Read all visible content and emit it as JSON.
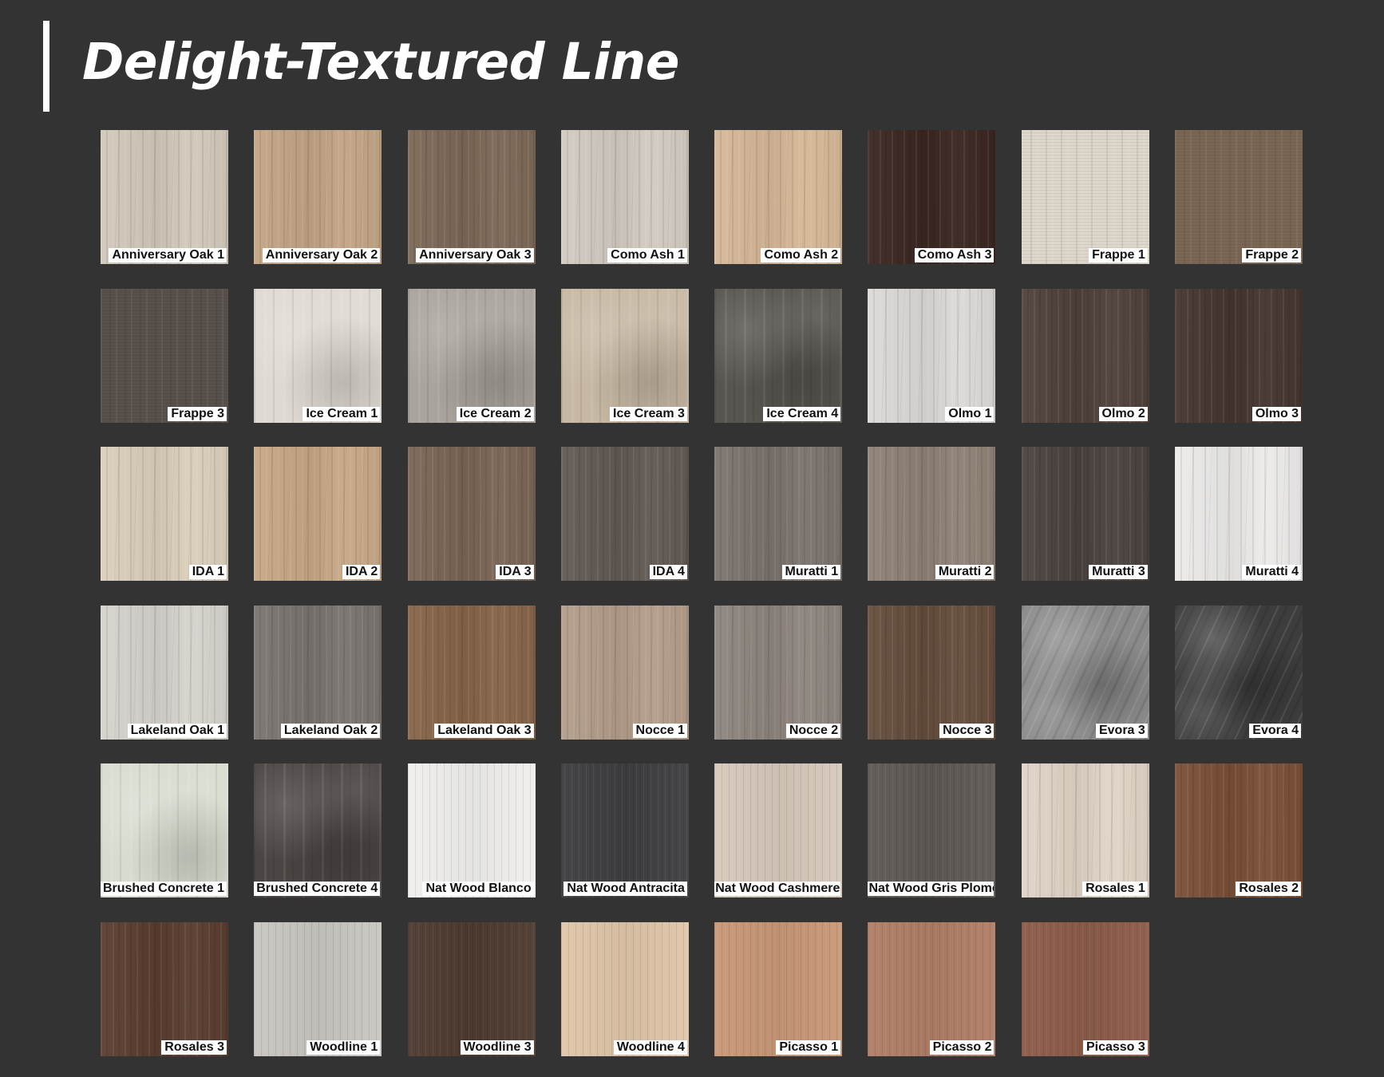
{
  "title": "Delight-Textured Line",
  "swatches": [
    {
      "label": "Anniversary Oak 1",
      "base": "#d2c9bb",
      "grain": "vertical"
    },
    {
      "label": "Anniversary Oak 2",
      "base": "#c3a585",
      "grain": "vertical"
    },
    {
      "label": "Anniversary Oak 3",
      "base": "#7c6856",
      "grain": "vertical"
    },
    {
      "label": "Como Ash 1",
      "base": "#d3cbc1",
      "grain": "vertical"
    },
    {
      "label": "Como Ash 2",
      "base": "#d6b897",
      "grain": "vertical"
    },
    {
      "label": "Como Ash 3",
      "base": "#3b2621",
      "grain": "vertical"
    },
    {
      "label": "Frappe 1",
      "base": "#ddd6cb",
      "grain": "linen"
    },
    {
      "label": "Frappe 2",
      "base": "#7b6654",
      "grain": "linen"
    },
    {
      "label": "Frappe 3",
      "base": "#57504b",
      "grain": "linen"
    },
    {
      "label": "Ice Cream 1",
      "base": "#ded9d2",
      "grain": "mottled"
    },
    {
      "label": "Ice Cream 2",
      "base": "#a8a39c",
      "grain": "mottled"
    },
    {
      "label": "Ice Cream 3",
      "base": "#c7b8a3",
      "grain": "mottled"
    },
    {
      "label": "Ice Cream 4",
      "base": "#58544f",
      "grain": "mottled"
    },
    {
      "label": "Olmo 1",
      "base": "#dcdad6",
      "grain": "vertical"
    },
    {
      "label": "Olmo 2",
      "base": "#4f4139",
      "grain": "vertical"
    },
    {
      "label": "Olmo 3",
      "base": "#45352e",
      "grain": "vertical"
    },
    {
      "label": "IDA 1",
      "base": "#dbcfbb",
      "grain": "vertical"
    },
    {
      "label": "IDA 2",
      "base": "#c8a887",
      "grain": "vertical"
    },
    {
      "label": "IDA 3",
      "base": "#7a6555",
      "grain": "vertical"
    },
    {
      "label": "IDA 4",
      "base": "#625a53",
      "grain": "vertical"
    },
    {
      "label": "Muratti 1",
      "base": "#7b736d",
      "grain": "vertical"
    },
    {
      "label": "Muratti 2",
      "base": "#8f8176",
      "grain": "vertical"
    },
    {
      "label": "Muratti 3",
      "base": "#4a423f",
      "grain": "vertical"
    },
    {
      "label": "Muratti 4",
      "base": "#ecebea",
      "grain": "vertical"
    },
    {
      "label": "Lakeland Oak 1",
      "base": "#d6d3cd",
      "grain": "vertical"
    },
    {
      "label": "Lakeland Oak 2",
      "base": "#7a7470",
      "grain": "vertical"
    },
    {
      "label": "Lakeland Oak 3",
      "base": "#866549",
      "grain": "vertical"
    },
    {
      "label": "Nocce 1",
      "base": "#b49d8a",
      "grain": "vertical"
    },
    {
      "label": "Nocce 2",
      "base": "#8e857e",
      "grain": "vertical"
    },
    {
      "label": "Nocce 3",
      "base": "#654d3c",
      "grain": "vertical"
    },
    {
      "label": "Evora 3",
      "base": "#8a8a8b",
      "grain": "marble"
    },
    {
      "label": "Evora 4",
      "base": "#3d3d3e",
      "grain": "marble"
    },
    {
      "label": "Brushed Concrete 1",
      "base": "#d8dccf",
      "grain": "mottled"
    },
    {
      "label": "Brushed Concrete 4",
      "base": "#4a4542",
      "grain": "mottled"
    },
    {
      "label": "Nat Wood Blanco",
      "base": "#f0efee",
      "grain": "fine"
    },
    {
      "label": "Nat Wood Antracita",
      "base": "#3f3e41",
      "grain": "fine"
    },
    {
      "label": "Nat Wood Cashmere",
      "base": "#d7c9bb",
      "grain": "fine"
    },
    {
      "label": "Nat Wood Gris Plomo",
      "base": "#5e5954",
      "grain": "fine"
    },
    {
      "label": "Rosales 1",
      "base": "#e0d4c5",
      "grain": "vertical"
    },
    {
      "label": "Rosales 2",
      "base": "#7a4f36",
      "grain": "vertical"
    },
    {
      "label": "Rosales 3",
      "base": "#5a3d2f",
      "grain": "vertical"
    },
    {
      "label": "Woodline 1",
      "base": "#c9c6c2",
      "grain": "fine"
    },
    {
      "label": "Woodline 3",
      "base": "#4f3b30",
      "grain": "fine"
    },
    {
      "label": "Woodline 4",
      "base": "#e0c6a9",
      "grain": "fine"
    },
    {
      "label": "Picasso 1",
      "base": "#c99876",
      "grain": "fine"
    },
    {
      "label": "Picasso 2",
      "base": "#b07e66",
      "grain": "fine"
    },
    {
      "label": "Picasso 3",
      "base": "#8d5c49",
      "grain": "fine"
    }
  ]
}
